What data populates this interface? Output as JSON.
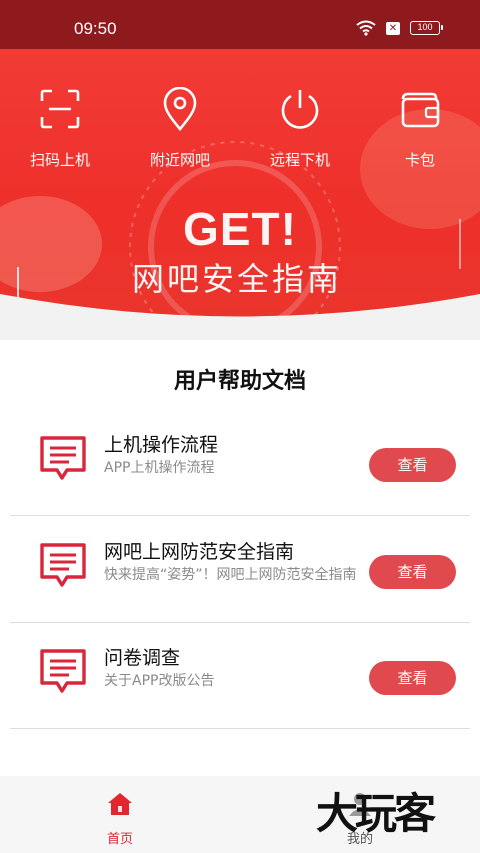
{
  "status_bar": {
    "time": "09:50",
    "battery": "100",
    "wifi_icon": "wifi-icon",
    "notification_icon": "x-box-icon"
  },
  "banner": {
    "quick_actions": [
      {
        "label": "扫码上机",
        "icon": "scan-icon"
      },
      {
        "label": "附近网吧",
        "icon": "location-pin-icon"
      },
      {
        "label": "远程下机",
        "icon": "power-icon"
      },
      {
        "label": "卡包",
        "icon": "wallet-icon"
      }
    ],
    "headline": "GET!",
    "subheadline": "网吧安全指南"
  },
  "help": {
    "title": "用户帮助文档",
    "docs": [
      {
        "title": "上机操作流程",
        "subtitle": "APP上机操作流程",
        "button": "查看",
        "icon": "document-message-icon"
      },
      {
        "title": "网吧上网防范安全指南",
        "subtitle": "快来提高“姿势”！网吧上网防范安全指南",
        "button": "查看",
        "icon": "document-message-icon"
      },
      {
        "title": "问卷调查",
        "subtitle": "关于APP改版公告",
        "button": "查看",
        "icon": "document-message-icon"
      }
    ]
  },
  "tabbar": {
    "tabs": [
      {
        "label": "首页",
        "icon": "home-icon",
        "active": true
      },
      {
        "label": "我的",
        "icon": "user-icon",
        "active": false
      }
    ],
    "active_color": "#e0272f"
  },
  "watermark": "大玩客",
  "colors": {
    "status_bar": "#8e1a1e",
    "banner": "#ee2f2a",
    "button": "#e04a4f",
    "accent": "#e0272f"
  }
}
